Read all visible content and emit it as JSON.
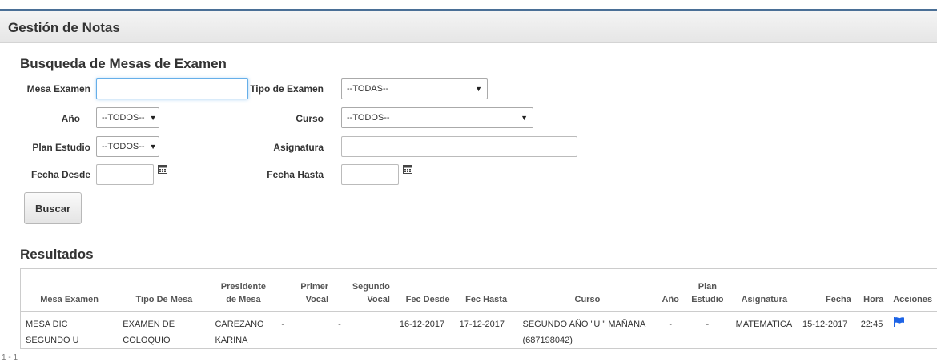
{
  "header": {
    "title": "Gestión de Notas"
  },
  "search": {
    "title": "Busqueda de Mesas de Examen",
    "mesa_examen_label": "Mesa Examen",
    "mesa_examen_value": "",
    "tipo_examen_label": "Tipo de Examen",
    "tipo_examen_value": "--TODAS--",
    "anio_label": "Año",
    "anio_value": "--TODOS--",
    "curso_label": "Curso",
    "curso_value": "--TODOS--",
    "plan_label": "Plan Estudio",
    "plan_value": "--TODOS--",
    "asignatura_label": "Asignatura",
    "asignatura_value": "",
    "fecha_desde_label": "Fecha Desde",
    "fecha_desde_value": "",
    "fecha_hasta_label": "Fecha Hasta",
    "fecha_hasta_value": "",
    "buscar_label": "Buscar"
  },
  "results": {
    "title": "Resultados",
    "columns": [
      "Mesa Examen",
      "Tipo De Mesa",
      "Presidente de Mesa",
      "Primer Vocal",
      "Segundo Vocal",
      "Fec Desde",
      "Fec Hasta",
      "Curso",
      "Año",
      "Plan Estudio",
      "Asignatura",
      "Fecha",
      "Hora",
      "Acciones"
    ],
    "rows": [
      {
        "mesa_examen": "MESA DIC SEGUNDO U",
        "tipo_mesa": "EXAMEN DE COLOQUIO",
        "presidente": "CAREZANO KARINA",
        "primer_vocal": "-",
        "segundo_vocal": "-",
        "fec_desde": "16-12-2017",
        "fec_hasta": "17-12-2017",
        "curso": "SEGUNDO AÑO \"U \" MAÑANA (687198042)",
        "anio": "-",
        "plan": "-",
        "asignatura": "MATEMATICA",
        "fecha": "15-12-2017",
        "hora": "22:45",
        "accion_icon": "flag-icon"
      }
    ],
    "pager": "1 - 1"
  },
  "colors": {
    "accent": "#4a6f96",
    "flag": "#1e64e6",
    "focus": "#66afe9"
  }
}
